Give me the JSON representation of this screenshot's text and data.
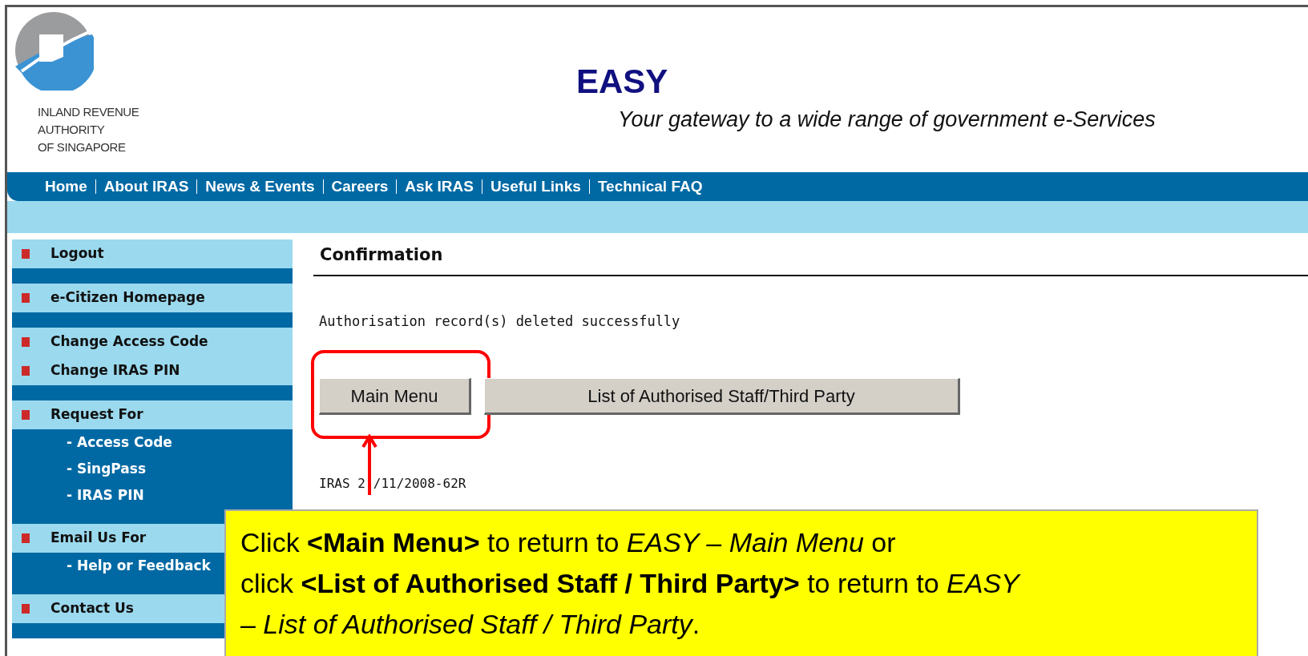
{
  "header": {
    "org_name": [
      "INLAND REVENUE",
      "AUTHORITY",
      "OF SINGAPORE"
    ],
    "title": "EASY",
    "tagline": "Your gateway to a wide range of government e-Services"
  },
  "nav": [
    {
      "label": "Home"
    },
    {
      "label": "About IRAS"
    },
    {
      "label": "News & Events"
    },
    {
      "label": "Careers"
    },
    {
      "label": "Ask IRAS"
    },
    {
      "label": "Useful Links"
    },
    {
      "label": "Technical FAQ"
    }
  ],
  "sidebar": {
    "groups": [
      [
        {
          "kind": "main",
          "label": "Logout"
        }
      ],
      [
        {
          "kind": "main",
          "label": "e-Citizen Homepage"
        }
      ],
      [
        {
          "kind": "main",
          "label": "Change Access Code"
        },
        {
          "kind": "main",
          "label": "Change IRAS PIN"
        }
      ],
      [
        {
          "kind": "main",
          "label": "Request For"
        },
        {
          "kind": "sub",
          "label": "- Access Code"
        },
        {
          "kind": "sub",
          "label": "- SingPass"
        },
        {
          "kind": "sub",
          "label": "- IRAS PIN"
        }
      ],
      [
        {
          "kind": "main",
          "label": "Email Us For"
        },
        {
          "kind": "sub",
          "label": "- Help or Feedback"
        }
      ],
      [
        {
          "kind": "main",
          "label": "Contact Us"
        }
      ]
    ]
  },
  "content": {
    "heading": "Confirmation",
    "message": "Authorisation record(s) deleted successfully",
    "buttons": [
      {
        "label": "Main Menu",
        "highlighted": true
      },
      {
        "label": "List of Authorised Staff/Third Party",
        "highlighted": false
      }
    ],
    "reference_start": "IRAS 2",
    "reference_end": "/11/2008-62R"
  },
  "callout": {
    "lines": [
      "Click **<Main Menu>** to return to *EASY – Main Menu* or",
      "click **<List of Authorised Staff / Third Party>** to return to *EASY*",
      "*– List of Authorised Staff / Third Party*."
    ]
  }
}
